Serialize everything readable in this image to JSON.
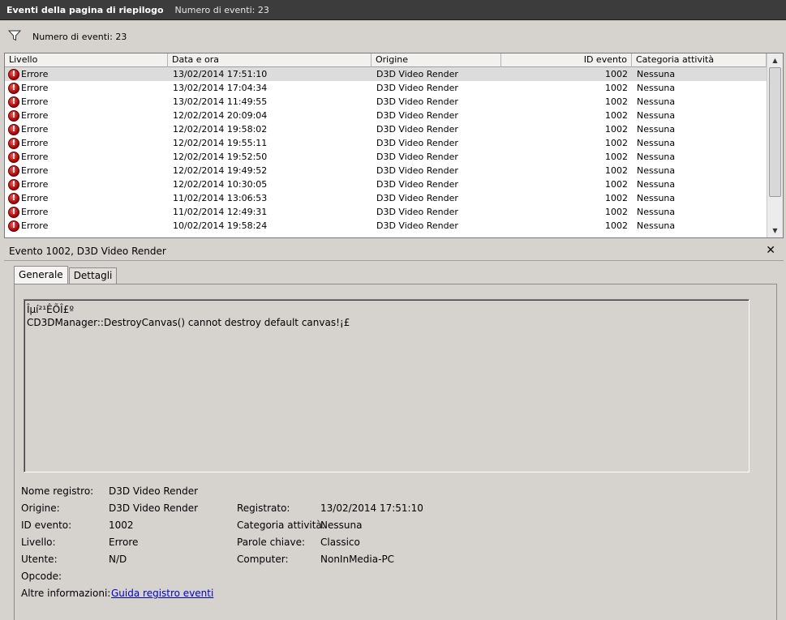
{
  "titlebar": {
    "title": "Eventi della pagina di riepilogo",
    "subtitle": "Numero di eventi: 23"
  },
  "filter": {
    "icon": "filter-icon",
    "count_label": "Numero di eventi: 23"
  },
  "grid": {
    "columns": [
      "Livello",
      "Data e ora",
      "Origine",
      "ID evento",
      "Categoria attività"
    ],
    "rows": [
      {
        "level": "Errore",
        "date": "13/02/2014 17:51:10",
        "source": "D3D Video Render",
        "id": "1002",
        "category": "Nessuna"
      },
      {
        "level": "Errore",
        "date": "13/02/2014 17:04:34",
        "source": "D3D Video Render",
        "id": "1002",
        "category": "Nessuna"
      },
      {
        "level": "Errore",
        "date": "13/02/2014 11:49:55",
        "source": "D3D Video Render",
        "id": "1002",
        "category": "Nessuna"
      },
      {
        "level": "Errore",
        "date": "12/02/2014 20:09:04",
        "source": "D3D Video Render",
        "id": "1002",
        "category": "Nessuna"
      },
      {
        "level": "Errore",
        "date": "12/02/2014 19:58:02",
        "source": "D3D Video Render",
        "id": "1002",
        "category": "Nessuna"
      },
      {
        "level": "Errore",
        "date": "12/02/2014 19:55:11",
        "source": "D3D Video Render",
        "id": "1002",
        "category": "Nessuna"
      },
      {
        "level": "Errore",
        "date": "12/02/2014 19:52:50",
        "source": "D3D Video Render",
        "id": "1002",
        "category": "Nessuna"
      },
      {
        "level": "Errore",
        "date": "12/02/2014 19:49:52",
        "source": "D3D Video Render",
        "id": "1002",
        "category": "Nessuna"
      },
      {
        "level": "Errore",
        "date": "12/02/2014 10:30:05",
        "source": "D3D Video Render",
        "id": "1002",
        "category": "Nessuna"
      },
      {
        "level": "Errore",
        "date": "11/02/2014 13:06:53",
        "source": "D3D Video Render",
        "id": "1002",
        "category": "Nessuna"
      },
      {
        "level": "Errore",
        "date": "11/02/2014 12:49:31",
        "source": "D3D Video Render",
        "id": "1002",
        "category": "Nessuna"
      },
      {
        "level": "Errore",
        "date": "10/02/2014 19:58:24",
        "source": "D3D Video Render",
        "id": "1002",
        "category": "Nessuna"
      }
    ]
  },
  "detail": {
    "header": "Evento 1002, D3D Video Render",
    "close": "✕",
    "tabs": [
      "Generale",
      "Dettagli"
    ],
    "message_line1": "Îµí²¹ÊÕÎ£º",
    "message_line2": "CD3DManager::DestroyCanvas() cannot destroy default canvas!¡£",
    "props": {
      "nome_registro_label": "Nome registro:",
      "nome_registro": "D3D Video Render",
      "origine_label": "Origine:",
      "origine": "D3D Video Render",
      "id_evento_label": "ID evento:",
      "id_evento": "1002",
      "livello_label": "Livello:",
      "livello": "Errore",
      "utente_label": "Utente:",
      "utente": "N/D",
      "opcode_label": "Opcode:",
      "altre_info_label": "Altre informazioni:",
      "altre_info_link": "Guida registro eventi",
      "registrato_label": "Registrato:",
      "registrato": "13/02/2014 17:51:10",
      "categoria_label": "Categoria attività:",
      "categoria": "Nessuna",
      "parole_label": "Parole chiave:",
      "parole": "Classico",
      "computer_label": "Computer:",
      "computer": "NonInMedia-PC"
    }
  }
}
